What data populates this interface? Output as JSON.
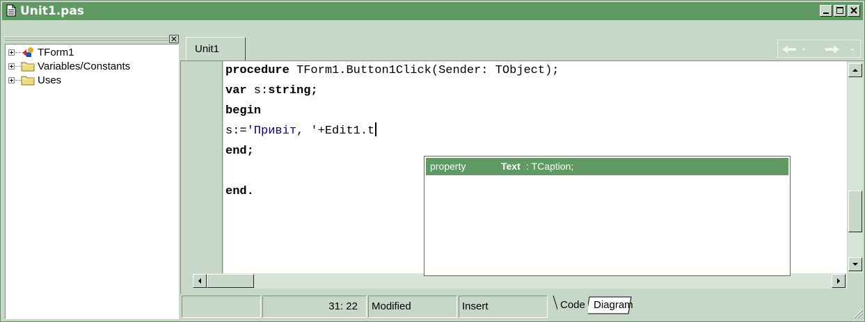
{
  "window": {
    "title": "Unit1.pas",
    "controls": [
      "minimize",
      "maximize",
      "close"
    ]
  },
  "left_pane": {
    "tree": [
      {
        "label": "TForm1",
        "icon": "form-component-icon"
      },
      {
        "label": "Variables/Constants",
        "icon": "folder-icon"
      },
      {
        "label": "Uses",
        "icon": "folder-icon"
      }
    ]
  },
  "editor": {
    "tab": "Unit1",
    "code_lines": [
      {
        "kw": "procedure",
        "rest": " TForm1.Button1Click(Sender: TObject);"
      },
      {
        "kw": "var",
        "rest": " s:",
        "kw2": "string",
        "rest2": ";"
      },
      {
        "kw": "begin"
      },
      {
        "pre": "s:=",
        "str": "'Привіт, '",
        "post": "+Edit1.t"
      },
      {
        "kw": "end",
        "rest": ";"
      },
      {
        "kw": "end",
        "rest": "."
      }
    ],
    "completion": {
      "kind": "property",
      "name": "Text",
      "type": ": TCaption;"
    }
  },
  "status": {
    "position": "31:  22",
    "modified": "Modified",
    "mode": "Insert",
    "views": [
      "Code",
      "Diagram"
    ]
  },
  "colors": {
    "titlebar": "#5e9a62",
    "chrome": "#c8d8c8",
    "selection": "#5e9a62",
    "string_literal": "#0000a0"
  }
}
